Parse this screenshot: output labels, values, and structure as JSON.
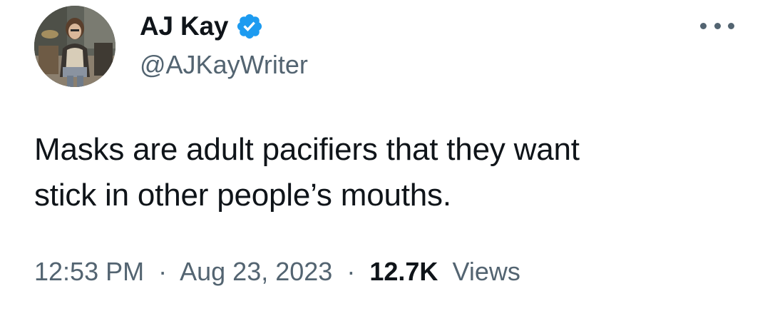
{
  "author": {
    "display_name": "AJ Kay",
    "handle": "@AJKayWriter",
    "verified": true,
    "verified_color": "#1d9bf0"
  },
  "tweet": {
    "text_line1": "Masks are adult pacifiers that they want",
    "text_line2": "stick in other people’s mouths."
  },
  "meta": {
    "time": "12:53 PM",
    "separator": "·",
    "date": "Aug 23, 2023",
    "views_count": "12.7K",
    "views_label": "Views"
  },
  "icons": {
    "more": "more-horizontal-icon",
    "verified": "verified-badge-icon"
  }
}
